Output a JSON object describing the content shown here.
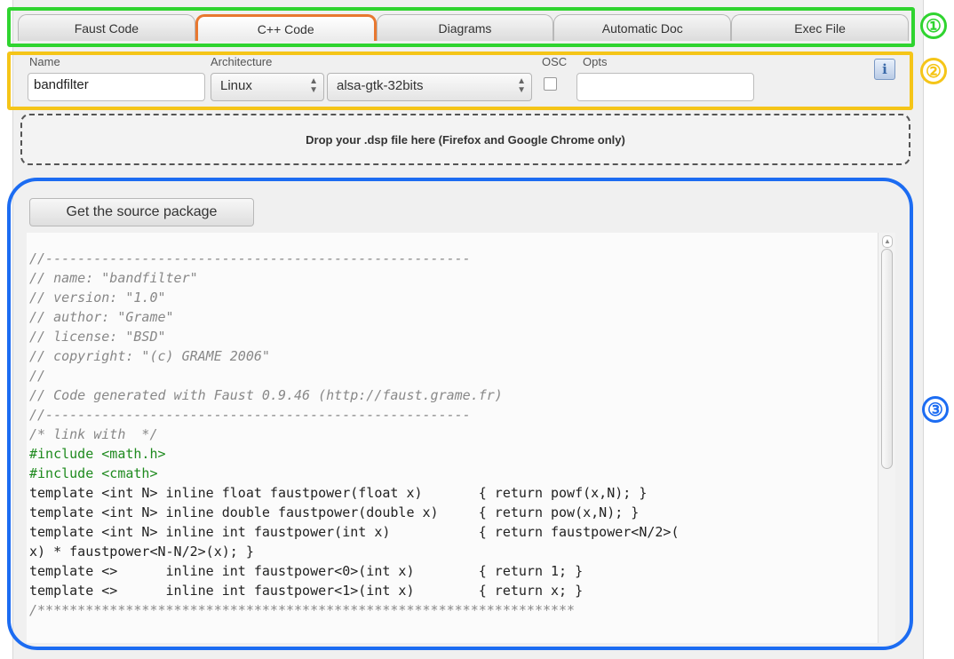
{
  "tabs": [
    "Faust Code",
    "C++ Code",
    "Diagrams",
    "Automatic Doc",
    "Exec File"
  ],
  "active_tab": "C++ Code",
  "form": {
    "name_label": "Name",
    "name_value": "bandfilter",
    "architecture_label": "Architecture",
    "os_value": "Linux",
    "arch_value": "alsa-gtk-32bits",
    "osc_label": "OSC",
    "opts_label": "Opts",
    "opts_value": "",
    "info_glyph": "i"
  },
  "drop_zone": "Drop your .dsp file here (Firefox and Google Chrome only)",
  "source_button": "Get the source package",
  "annotations": [
    "①",
    "②",
    "③"
  ],
  "code_lines": [
    "//-----------------------------------------------------",
    "// name: \"bandfilter\"",
    "// version: \"1.0\"",
    "// author: \"Grame\"",
    "// license: \"BSD\"",
    "// copyright: \"(c) GRAME 2006\"",
    "//",
    "// Code generated with Faust 0.9.46 (http://faust.grame.fr)",
    "//-----------------------------------------------------",
    "/* link with  */",
    "#include <math.h>",
    "#include <cmath>",
    "template <int N> inline float faustpower(float x)       { return powf(x,N); }",
    "template <int N> inline double faustpower(double x)     { return pow(x,N); }",
    "template <int N> inline int faustpower(int x)           { return faustpower<N/2>(",
    "x) * faustpower<N-N/2>(x); }",
    "template <>      inline int faustpower<0>(int x)        { return 1; }",
    "template <>      inline int faustpower<1>(int x)        { return x; }",
    "/*******************************************************************"
  ],
  "colors": {
    "tabs_highlight": "#2fd42f",
    "form_highlight": "#f5c518",
    "code_highlight": "#1c6cf2",
    "active_tab_border": "#e87830"
  }
}
